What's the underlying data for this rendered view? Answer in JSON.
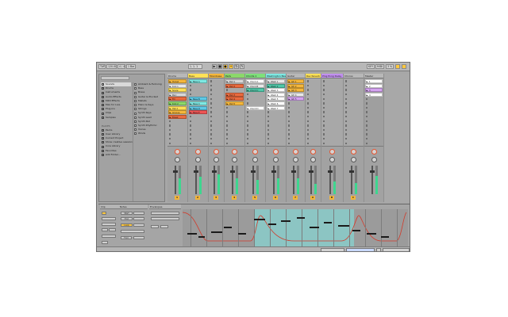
{
  "transport": {
    "tap_label": "TAP",
    "tempo": "120.00",
    "signature": "4 / 4",
    "quantize": "1 Bar",
    "position": "1. 1. 1",
    "key": "KEY",
    "midi": "MIDI",
    "cpu": "3 %"
  },
  "browser": {
    "categories": [
      {
        "label": "Sounds",
        "selected": true
      },
      {
        "label": "Drums"
      },
      {
        "label": "Instruments"
      },
      {
        "label": "Audio Effects"
      },
      {
        "label": "MIDI Effects"
      },
      {
        "label": "Max for Live"
      },
      {
        "label": "Plug-ins"
      },
      {
        "label": "Clips"
      },
      {
        "label": "Samples"
      }
    ],
    "places_heading": "PLACES",
    "places": [
      "Packs",
      "User Library",
      "Current Project",
      "Show creative sessions",
      "Core Library",
      "Favorites",
      "Add Folder..."
    ],
    "files": [
      "Ambient & Evolving",
      "Bass",
      "Brass",
      "Guitar & Plucked",
      "Mallets",
      "Piano & Keys",
      "Strings",
      "Synth Keys",
      "Synth Lead",
      "Synth Pad",
      "Synth Rhythmic",
      "Voices",
      "Winds"
    ]
  },
  "tracks": [
    {
      "name": "Drums",
      "color": "#b8b8b8",
      "clips": [
        {
          "label": "Hi-hat",
          "color": "#f5b73b"
        },
        {
          "label": "Kick 1",
          "color": "#e8e8e8"
        },
        {
          "label": "Snare",
          "color": "#ffe156"
        },
        {
          "label": "Perc",
          "color": "#d7d7d7"
        },
        {
          "label": "Fill",
          "color": "#ea6a3e"
        },
        {
          "label": "Kick 2",
          "color": "#8bd86a"
        },
        {
          "label": "Hat 2",
          "color": "#ffe156"
        },
        {
          "label": "Groove",
          "color": "#f5b73b"
        },
        {
          "label": "Break",
          "color": "#ea6a3e"
        }
      ],
      "num": "1"
    },
    {
      "name": "Bass",
      "color": "#ffe156",
      "clips": [
        {
          "label": "Bass A",
          "color": "#7ee8e2"
        },
        {
          "label": "",
          "color": ""
        },
        {
          "label": "",
          "color": ""
        },
        {
          "label": "",
          "color": ""
        },
        {
          "label": "Bass B",
          "color": "#5ec9e6"
        },
        {
          "label": "Bass C",
          "color": "#7ee8e2"
        },
        {
          "label": "Bass D",
          "color": "#5ec9e6"
        },
        {
          "label": "Bass E",
          "color": "#e55"
        }
      ],
      "num": "2"
    },
    {
      "name": "Moonbase",
      "color": "#f5b73b",
      "clips": [],
      "num": "3"
    },
    {
      "name": "Pads",
      "color": "#8bd86a",
      "clips": [
        {
          "label": "Pad 1",
          "color": "#d7d7d7"
        },
        {
          "label": "Pad 2",
          "color": "#ea6a3e"
        },
        {
          "label": "",
          "color": ""
        },
        {
          "label": "Pad 3",
          "color": "#ea6a3e"
        },
        {
          "label": "Pad 4",
          "color": "#ea6a3e"
        },
        {
          "label": "Pad 5",
          "color": "#f5b73b"
        }
      ],
      "num": "4"
    },
    {
      "name": "Chords 1",
      "color": "#7ee07a",
      "clips": [
        {
          "label": "Chord A",
          "color": "#fff"
        },
        {
          "label": "Chord B",
          "color": "#e8e8e8"
        },
        {
          "label": "Chord C",
          "color": "#4fc7a8"
        },
        {
          "label": "",
          "color": ""
        },
        {
          "label": "",
          "color": ""
        },
        {
          "label": "",
          "color": ""
        },
        {
          "label": "Chord D",
          "color": "#fff"
        }
      ],
      "num": "5"
    },
    {
      "name": "Washington Bass",
      "color": "#7ee8e2",
      "clips": [
        {
          "label": "Wash 1",
          "color": "#e8e8e8"
        },
        {
          "label": "Wash 2",
          "color": "#4fc7a8"
        },
        {
          "label": "Wash 3",
          "color": "#fff"
        },
        {
          "label": "Wash 4",
          "color": "#fff"
        },
        {
          "label": "Wash 5",
          "color": "#fff"
        },
        {
          "label": "Wash 6",
          "color": "#fff"
        },
        {
          "label": "Wash 7",
          "color": "#fff"
        }
      ],
      "num": "6"
    },
    {
      "name": "Guitar",
      "color": "#b8b8b8",
      "clips": [
        {
          "label": "Gtr 1",
          "color": "#f5b73b"
        },
        {
          "label": "Gtr 2",
          "color": "#f5b73b"
        },
        {
          "label": "Gtr 3",
          "color": "#f5b73b"
        },
        {
          "label": "Gtr 4",
          "color": "#e8e8e8"
        },
        {
          "label": "Gtr 5",
          "color": "#d4a2f0"
        }
      ],
      "num": "7"
    },
    {
      "name": "Rev Reverb",
      "color": "#ffe156",
      "clips": [],
      "num": "A"
    },
    {
      "name": "Ping Pong Delay",
      "color": "#c290f0",
      "clips": [],
      "num": "B"
    },
    {
      "name": "Chorus",
      "color": "#b8b8b8",
      "clips": [],
      "num": "C"
    },
    {
      "name": "Master",
      "color": "#b8b8b8",
      "clips": [
        {
          "label": "1",
          "color": "#ffffff"
        },
        {
          "label": "2",
          "color": "#ffffff"
        },
        {
          "label": "3",
          "color": "#d4a2f0"
        },
        {
          "label": "4",
          "color": "#ffffff"
        }
      ],
      "num": ""
    }
  ],
  "detail": {
    "clip_title": "Clip",
    "notes_title": "Notes",
    "envelopes_title": "Envelopes",
    "start_label": "Start",
    "end_label": "End",
    "loop_label": "Loop",
    "fold_label": "Fold"
  },
  "status": {
    "text": ""
  }
}
